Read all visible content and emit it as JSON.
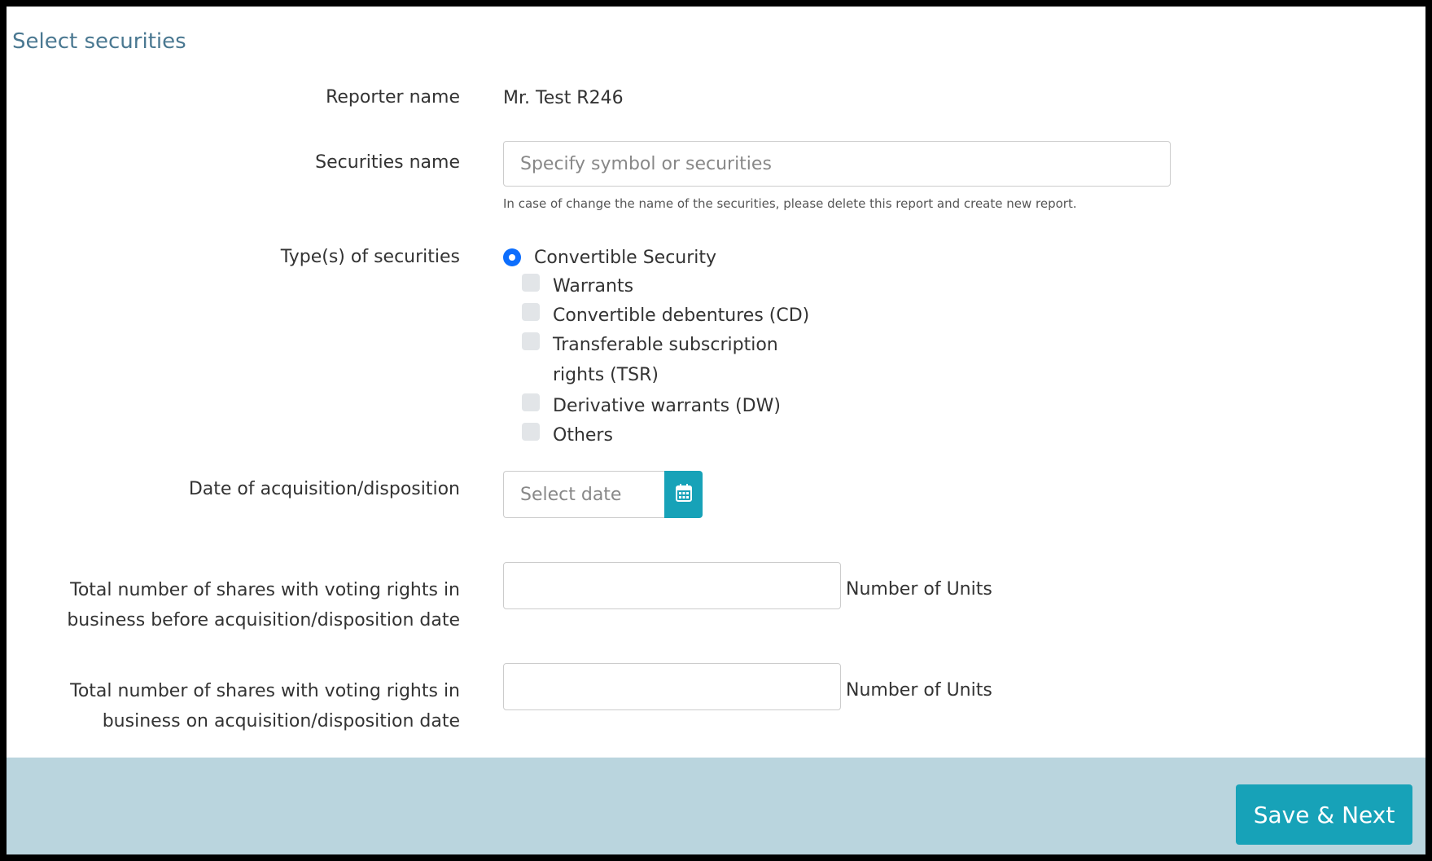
{
  "header": {
    "title": "Select securities"
  },
  "form": {
    "reporter": {
      "label": "Reporter name",
      "value": "Mr. Test R246"
    },
    "securities": {
      "label": "Securities name",
      "placeholder": "Specify symbol or securities",
      "help": "In case of change the name of the securities, please delete this report and create new report."
    },
    "types": {
      "label": "Type(s) of securities",
      "radio_label": "Convertible Security",
      "radio_selected": true,
      "options": [
        {
          "label": "Warrants",
          "checked": false
        },
        {
          "label": "Convertible debentures (CD)",
          "checked": false
        },
        {
          "label": "Transferable subscription rights (TSR)",
          "checked": false
        },
        {
          "label": "Derivative warrants (DW)",
          "checked": false
        },
        {
          "label": "Others",
          "checked": false
        }
      ]
    },
    "date": {
      "label": "Date of acquisition/disposition",
      "placeholder": "Select date"
    },
    "shares_before": {
      "label": "Total number of shares with voting rights in business before acquisition/disposition date",
      "value": "",
      "unit": "Number of Units"
    },
    "shares_on": {
      "label": "Total number of shares with voting rights in business on acquisition/disposition date",
      "value": "",
      "unit": "Number of Units"
    }
  },
  "footer": {
    "save_label": "Save & Next"
  },
  "icons": {
    "calendar": "calendar-icon"
  },
  "colors": {
    "accent": "#17a2b8",
    "radio": "#0d6efd",
    "footer_bg": "#bad5de",
    "title": "#4a7891"
  }
}
